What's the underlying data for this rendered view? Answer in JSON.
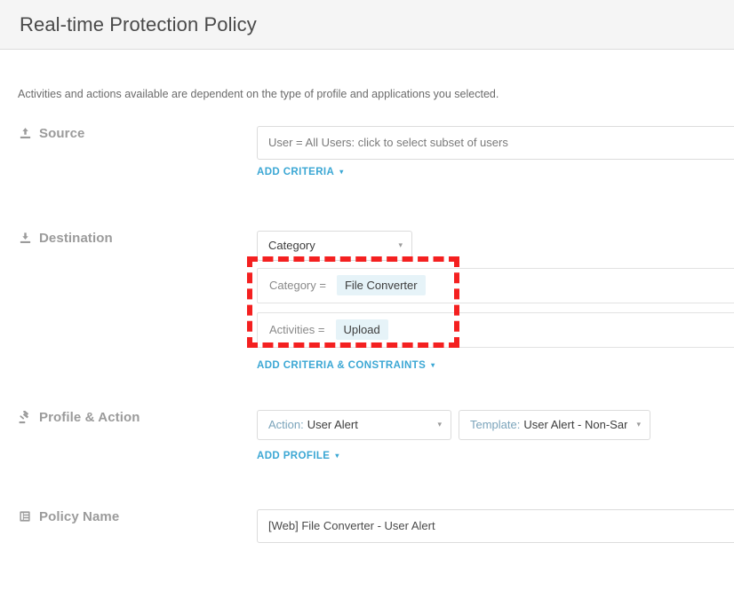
{
  "header": {
    "title": "Real-time Protection Policy"
  },
  "intro": {
    "text": "Activities and actions available are dependent on the type of profile and applications you selected."
  },
  "colors": {
    "link": "#3ba7d4",
    "annotation": "#f42020",
    "tag_background": "#e6f3f8",
    "header_background": "#f5f5f5",
    "label_text": "#9b9b9b"
  },
  "sections": {
    "source": {
      "label": "Source",
      "icon": "upload-icon",
      "field_value": "User = All Users: click to select subset of users",
      "add_link": {
        "label": "ADD CRITERIA",
        "caret": "▾"
      }
    },
    "destination": {
      "label": "Destination",
      "icon": "download-icon",
      "category_select": {
        "value": "Category",
        "caret": "▾"
      },
      "criteria": [
        {
          "key": "Category =",
          "tag": "File Converter"
        },
        {
          "key": "Activities =",
          "tag": "Upload"
        }
      ],
      "add_link": {
        "label": "ADD CRITERIA & CONSTRAINTS",
        "caret": "▾"
      }
    },
    "profile_action": {
      "label": "Profile & Action",
      "icon": "gavel-icon",
      "action_select": {
        "prefix": "Action:",
        "value": "User Alert",
        "caret": "▾"
      },
      "template_select": {
        "prefix": "Template:",
        "value": "User Alert - Non-Sar",
        "caret": "▾"
      },
      "add_link": {
        "label": "ADD PROFILE",
        "caret": "▾"
      }
    },
    "policy_name": {
      "label": "Policy Name",
      "icon": "document-icon",
      "field_value": "[Web] File Converter - User Alert"
    }
  }
}
